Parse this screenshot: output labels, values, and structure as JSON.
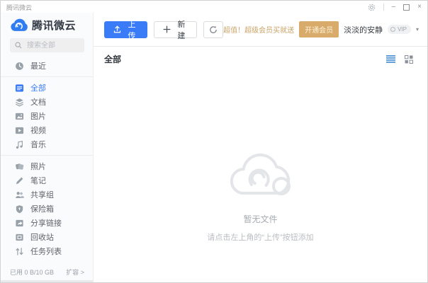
{
  "window": {
    "title": "腾讯微云"
  },
  "icons": {
    "minimize": "–",
    "close": "×",
    "caret_down": "▾",
    "semantic_names": [
      "cloud-logo-icon",
      "search-icon",
      "clock-icon",
      "all-files-icon",
      "documents-icon",
      "pictures-icon",
      "videos-icon",
      "music-icon",
      "photos-icon",
      "notes-icon",
      "shared-group-icon",
      "safebox-icon",
      "share-link-icon",
      "recycle-bin-icon",
      "task-list-icon",
      "upload-icon",
      "plus-icon",
      "refresh-icon",
      "vip-dot-icon",
      "list-view-icon",
      "grid-view-icon",
      "gear-icon",
      "empty-cloud-icon"
    ]
  },
  "colors": {
    "accent_blue": "#3a7bf8",
    "promo_gold": "#c9a467",
    "vip_button_gold": "#d8ab6a",
    "icon_grey": "#98a0a8",
    "empty_grey": "#e3e5e8"
  },
  "sidebar": {
    "logo_text": "腾讯微云",
    "search_placeholder": "搜索全部",
    "nav1": [
      {
        "label": "最近"
      }
    ],
    "nav2": [
      {
        "label": "全部",
        "active": true
      },
      {
        "label": "文档"
      },
      {
        "label": "图片"
      },
      {
        "label": "视频"
      },
      {
        "label": "音乐"
      }
    ],
    "nav3": [
      {
        "label": "照片"
      },
      {
        "label": "笔记"
      },
      {
        "label": "共享组"
      },
      {
        "label": "保险箱"
      },
      {
        "label": "分享链接"
      },
      {
        "label": "回收站"
      },
      {
        "label": "任务列表"
      }
    ],
    "storage_used": "已用 0 B/10 GB",
    "expand_label": "扩容 >"
  },
  "toolbar": {
    "upload_label": "上传",
    "new_label": "新建",
    "promo_text": "超值！超级会员买就送",
    "vip_button_label": "开通会员",
    "username": "淡淡的安静",
    "vip_badge": "VIP"
  },
  "content": {
    "header_title": "全部",
    "empty_title": "暂无文件",
    "empty_hint": "请点击左上角的“上传”按钮添加"
  }
}
